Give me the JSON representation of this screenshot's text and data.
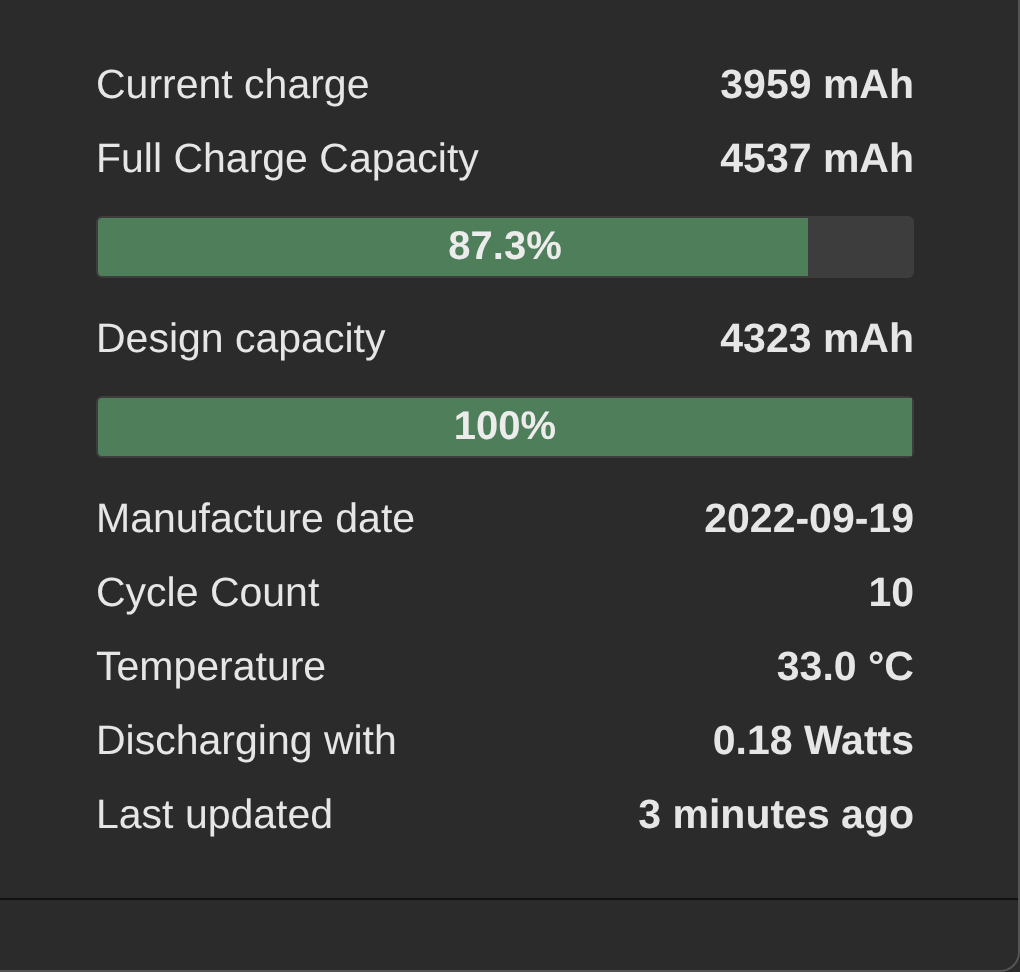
{
  "items": [
    {
      "kind": "row",
      "label": "Current charge",
      "value": "3959 mAh"
    },
    {
      "kind": "row",
      "label": "Full Charge Capacity",
      "value": "4537 mAh"
    },
    {
      "kind": "bar",
      "text": "87.3%",
      "level": 0.873
    },
    {
      "kind": "row",
      "label": "Design capacity",
      "value": "4323 mAh"
    },
    {
      "kind": "bar",
      "text": "100%",
      "level": 1
    },
    {
      "kind": "row",
      "label": "Manufacture date",
      "value": "2022-09-19"
    },
    {
      "kind": "row",
      "label": "Cycle Count",
      "value": "10"
    },
    {
      "kind": "row",
      "label": "Temperature",
      "value": "33.0 °C"
    },
    {
      "kind": "row",
      "label": "Discharging with",
      "value": "0.18 Watts"
    },
    {
      "kind": "row",
      "label": "Last updated",
      "value": "3 minutes ago"
    }
  ]
}
